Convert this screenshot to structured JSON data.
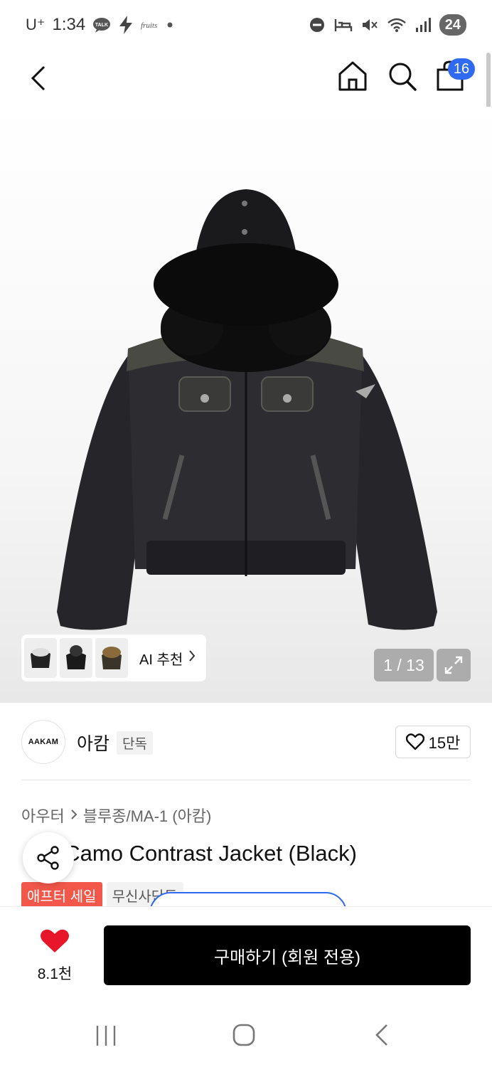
{
  "status_bar": {
    "carrier": "U⁺",
    "time": "1:34",
    "battery": "24",
    "icons": [
      "talk-icon",
      "bolt-icon",
      "app-icon",
      "dot-icon",
      "dnd-icon",
      "bed-icon",
      "mute-icon",
      "wifi-icon",
      "signal-icon"
    ]
  },
  "top_nav": {
    "icons": [
      "back-icon",
      "home-icon",
      "search-icon",
      "cart-icon"
    ],
    "cart_badge": "16"
  },
  "gallery": {
    "ai_recommend_label": "AI 추천",
    "counter": "1 / 13",
    "expand_icon": "expand-icon"
  },
  "brand": {
    "logo_text": "AAKAM",
    "name": "아캄",
    "tag": "단독",
    "like_count": "15만"
  },
  "breadcrumb": {
    "category": "아우터",
    "subcategory": "블루종/MA-1 (아캄)"
  },
  "product": {
    "title": "Camo Contrast Jacket (Black)",
    "tag_sale": "애프터 세일",
    "tag_exclusive": "무신사단독"
  },
  "bottom_bar": {
    "like_count": "8.1천",
    "buy_label": "구매하기 (회원 전용)"
  },
  "colors": {
    "accent_blue": "#2F6AF0",
    "sale_red": "#F2574A",
    "heart_red": "#E8162B",
    "buy_black": "#000000"
  }
}
